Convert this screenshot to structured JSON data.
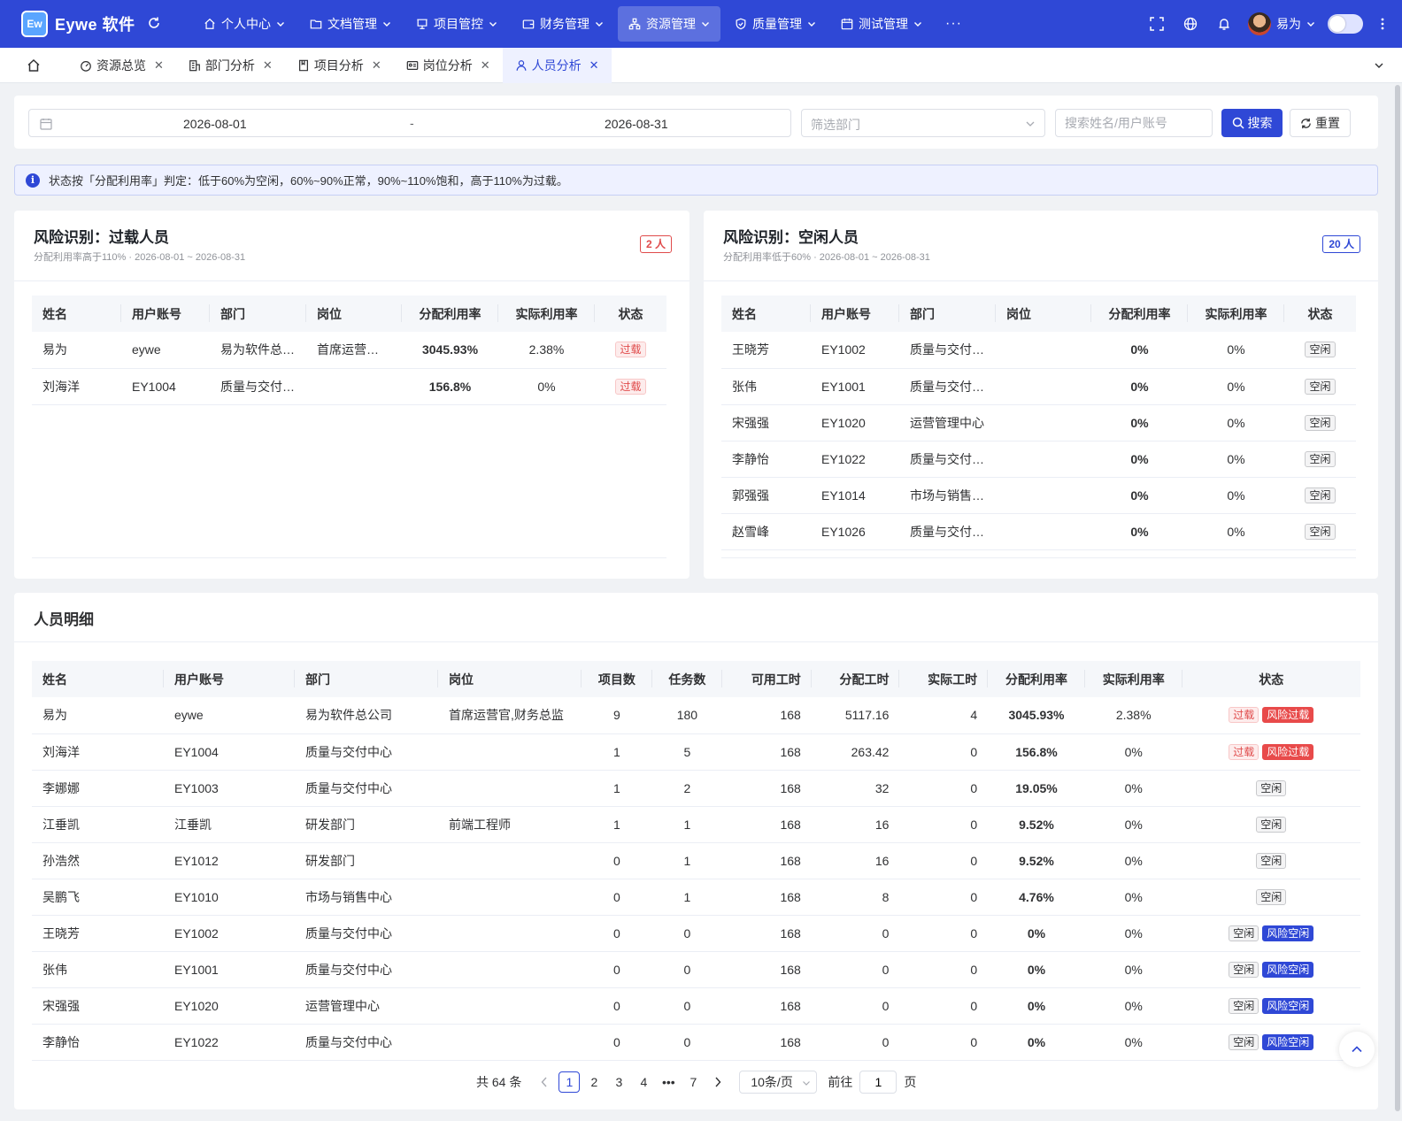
{
  "app": {
    "logo_text": "Ew",
    "title": "Eywe 软件"
  },
  "menu": [
    {
      "label": "个人中心",
      "icon": "home-icon"
    },
    {
      "label": "文档管理",
      "icon": "folder-icon"
    },
    {
      "label": "项目管控",
      "icon": "presentation-icon"
    },
    {
      "label": "财务管理",
      "icon": "wallet-icon"
    },
    {
      "label": "资源管理",
      "icon": "cluster-icon",
      "active": true
    },
    {
      "label": "质量管理",
      "icon": "shield-icon"
    },
    {
      "label": "测试管理",
      "icon": "calendar-icon"
    }
  ],
  "menu_more": "···",
  "user": {
    "name": "易为"
  },
  "tabs": [
    {
      "label": "资源总览",
      "icon": "dashboard-icon"
    },
    {
      "label": "部门分析",
      "icon": "building-icon"
    },
    {
      "label": "项目分析",
      "icon": "book-icon"
    },
    {
      "label": "岗位分析",
      "icon": "id-card-icon"
    },
    {
      "label": "人员分析",
      "icon": "user-icon",
      "active": true
    }
  ],
  "filter": {
    "start_date": "2026-08-01",
    "separator": "-",
    "end_date": "2026-08-31",
    "dept_placeholder": "筛选部门",
    "search_placeholder": "搜索姓名/用户账号",
    "search_btn": "搜索",
    "reset_btn": "重置"
  },
  "notice": "状态按「分配利用率」判定：低于60%为空闲，60%~90%正常，90%~110%饱和，高于110%为过载。",
  "overload": {
    "title": "风险识别：过载人员",
    "subtitle": "分配利用率高于110% · 2026-08-01 ~ 2026-08-31",
    "count": "2 人",
    "columns": [
      "姓名",
      "用户账号",
      "部门",
      "岗位",
      "分配利用率",
      "实际利用率",
      "状态"
    ],
    "rows": [
      [
        "易为",
        "eywe",
        "易为软件总…",
        "首席运营…",
        "3045.93%",
        "2.38%",
        "过载"
      ],
      [
        "刘海洋",
        "EY1004",
        "质量与交付…",
        "",
        "156.8%",
        "0%",
        "过载"
      ]
    ]
  },
  "idle": {
    "title": "风险识别：空闲人员",
    "subtitle": "分配利用率低于60% · 2026-08-01 ~ 2026-08-31",
    "count": "20 人",
    "columns": [
      "姓名",
      "用户账号",
      "部门",
      "岗位",
      "分配利用率",
      "实际利用率",
      "状态"
    ],
    "rows": [
      [
        "王晓芳",
        "EY1002",
        "质量与交付…",
        "",
        "0%",
        "0%",
        "空闲"
      ],
      [
        "张伟",
        "EY1001",
        "质量与交付…",
        "",
        "0%",
        "0%",
        "空闲"
      ],
      [
        "宋强强",
        "EY1020",
        "运营管理中心",
        "",
        "0%",
        "0%",
        "空闲"
      ],
      [
        "李静怡",
        "EY1022",
        "质量与交付…",
        "",
        "0%",
        "0%",
        "空闲"
      ],
      [
        "郭强强",
        "EY1014",
        "市场与销售…",
        "",
        "0%",
        "0%",
        "空闲"
      ],
      [
        "赵雪峰",
        "EY1026",
        "质量与交付…",
        "",
        "0%",
        "0%",
        "空闲"
      ]
    ]
  },
  "detail": {
    "title": "人员明细",
    "columns": [
      "姓名",
      "用户账号",
      "部门",
      "岗位",
      "项目数",
      "任务数",
      "可用工时",
      "分配工时",
      "实际工时",
      "分配利用率",
      "实际利用率",
      "状态"
    ],
    "rows": [
      {
        "cells": [
          "易为",
          "eywe",
          "易为软件总公司",
          "首席运营官,财务总监",
          "9",
          "180",
          "168",
          "5117.16",
          "4",
          "3045.93%",
          "2.38%"
        ],
        "level": "red",
        "tags": [
          {
            "text": "过载",
            "kind": "over"
          },
          {
            "text": "风险过载",
            "kind": "risk-over"
          }
        ]
      },
      {
        "cells": [
          "刘海洋",
          "EY1004",
          "质量与交付中心",
          "",
          "1",
          "5",
          "168",
          "263.42",
          "0",
          "156.8%",
          "0%"
        ],
        "level": "red",
        "tags": [
          {
            "text": "过载",
            "kind": "over"
          },
          {
            "text": "风险过载",
            "kind": "risk-over"
          }
        ]
      },
      {
        "cells": [
          "李娜娜",
          "EY1003",
          "质量与交付中心",
          "",
          "1",
          "2",
          "168",
          "32",
          "0",
          "19.05%",
          "0%"
        ],
        "level": "blue",
        "tags": [
          {
            "text": "空闲",
            "kind": "idle"
          }
        ]
      },
      {
        "cells": [
          "江垂凯",
          "江垂凯",
          "研发部门",
          "前端工程师",
          "1",
          "1",
          "168",
          "16",
          "0",
          "9.52%",
          "0%"
        ],
        "level": "blue",
        "tags": [
          {
            "text": "空闲",
            "kind": "idle"
          }
        ]
      },
      {
        "cells": [
          "孙浩然",
          "EY1012",
          "研发部门",
          "",
          "0",
          "1",
          "168",
          "16",
          "0",
          "9.52%",
          "0%"
        ],
        "level": "blue",
        "tags": [
          {
            "text": "空闲",
            "kind": "idle"
          }
        ]
      },
      {
        "cells": [
          "吴鹏飞",
          "EY1010",
          "市场与销售中心",
          "",
          "0",
          "1",
          "168",
          "8",
          "0",
          "4.76%",
          "0%"
        ],
        "level": "blue",
        "tags": [
          {
            "text": "空闲",
            "kind": "idle"
          }
        ]
      },
      {
        "cells": [
          "王晓芳",
          "EY1002",
          "质量与交付中心",
          "",
          "0",
          "0",
          "168",
          "0",
          "0",
          "0%",
          "0%"
        ],
        "level": "blue",
        "tags": [
          {
            "text": "空闲",
            "kind": "idle"
          },
          {
            "text": "风险空闲",
            "kind": "risk-idle"
          }
        ]
      },
      {
        "cells": [
          "张伟",
          "EY1001",
          "质量与交付中心",
          "",
          "0",
          "0",
          "168",
          "0",
          "0",
          "0%",
          "0%"
        ],
        "level": "blue",
        "tags": [
          {
            "text": "空闲",
            "kind": "idle"
          },
          {
            "text": "风险空闲",
            "kind": "risk-idle"
          }
        ]
      },
      {
        "cells": [
          "宋强强",
          "EY1020",
          "运营管理中心",
          "",
          "0",
          "0",
          "168",
          "0",
          "0",
          "0%",
          "0%"
        ],
        "level": "blue",
        "tags": [
          {
            "text": "空闲",
            "kind": "idle"
          },
          {
            "text": "风险空闲",
            "kind": "risk-idle"
          }
        ]
      },
      {
        "cells": [
          "李静怡",
          "EY1022",
          "质量与交付中心",
          "",
          "0",
          "0",
          "168",
          "0",
          "0",
          "0%",
          "0%"
        ],
        "level": "blue",
        "tags": [
          {
            "text": "空闲",
            "kind": "idle"
          },
          {
            "text": "风险空闲",
            "kind": "risk-idle"
          }
        ]
      }
    ]
  },
  "pagination": {
    "total": "共 64 条",
    "pages": [
      "1",
      "2",
      "3",
      "4",
      "•••",
      "7"
    ],
    "current": "1",
    "page_size": "10条/页",
    "goto_label": "前往",
    "goto_value": "1",
    "page_unit": "页"
  },
  "colors": {
    "primary": "#2f48d6",
    "danger": "#e04b4b",
    "info": "#3c8fe6"
  }
}
